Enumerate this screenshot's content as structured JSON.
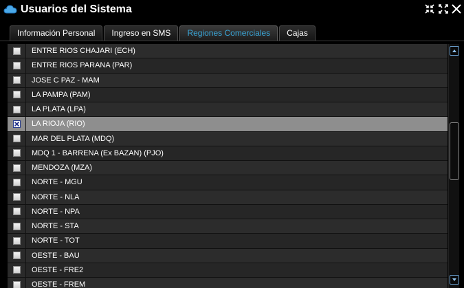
{
  "window": {
    "title": "Usuarios del Sistema"
  },
  "tabs": [
    {
      "label": "Información Personal",
      "active": false
    },
    {
      "label": "Ingreso en SMS",
      "active": false
    },
    {
      "label": "Regiones Comerciales",
      "active": true
    },
    {
      "label": "Cajas",
      "active": false
    }
  ],
  "regions": [
    {
      "label": "ENTRE RIOS CHAJARI (ECH)",
      "checked": false
    },
    {
      "label": "ENTRE RIOS PARANA (PAR)",
      "checked": false
    },
    {
      "label": "JOSE C PAZ - MAM",
      "checked": false
    },
    {
      "label": "LA PAMPA (PAM)",
      "checked": false
    },
    {
      "label": "LA PLATA (LPA)",
      "checked": false
    },
    {
      "label": "LA RIOJA (RIO)",
      "checked": true
    },
    {
      "label": "MAR DEL PLATA (MDQ)",
      "checked": false
    },
    {
      "label": "MDQ 1 - BARRENA (Ex BAZAN) (PJO)",
      "checked": false
    },
    {
      "label": "MENDOZA (MZA)",
      "checked": false
    },
    {
      "label": "NORTE - MGU",
      "checked": false
    },
    {
      "label": "NORTE - NLA",
      "checked": false
    },
    {
      "label": "NORTE - NPA",
      "checked": false
    },
    {
      "label": "NORTE - STA",
      "checked": false
    },
    {
      "label": "NORTE - TOT",
      "checked": false
    },
    {
      "label": "OESTE - BAU",
      "checked": false
    },
    {
      "label": "OESTE - FRE2",
      "checked": false
    },
    {
      "label": "OESTE - FREM",
      "checked": false
    }
  ],
  "colors": {
    "accent_tab": "#3aa6d8",
    "selected_row": "#8e8e8e",
    "title_icon": "#4aa8e8"
  },
  "icons": {
    "title": "cloud-icon",
    "window_buttons": [
      "collapse-icon",
      "expand-icon",
      "close-icon"
    ]
  }
}
